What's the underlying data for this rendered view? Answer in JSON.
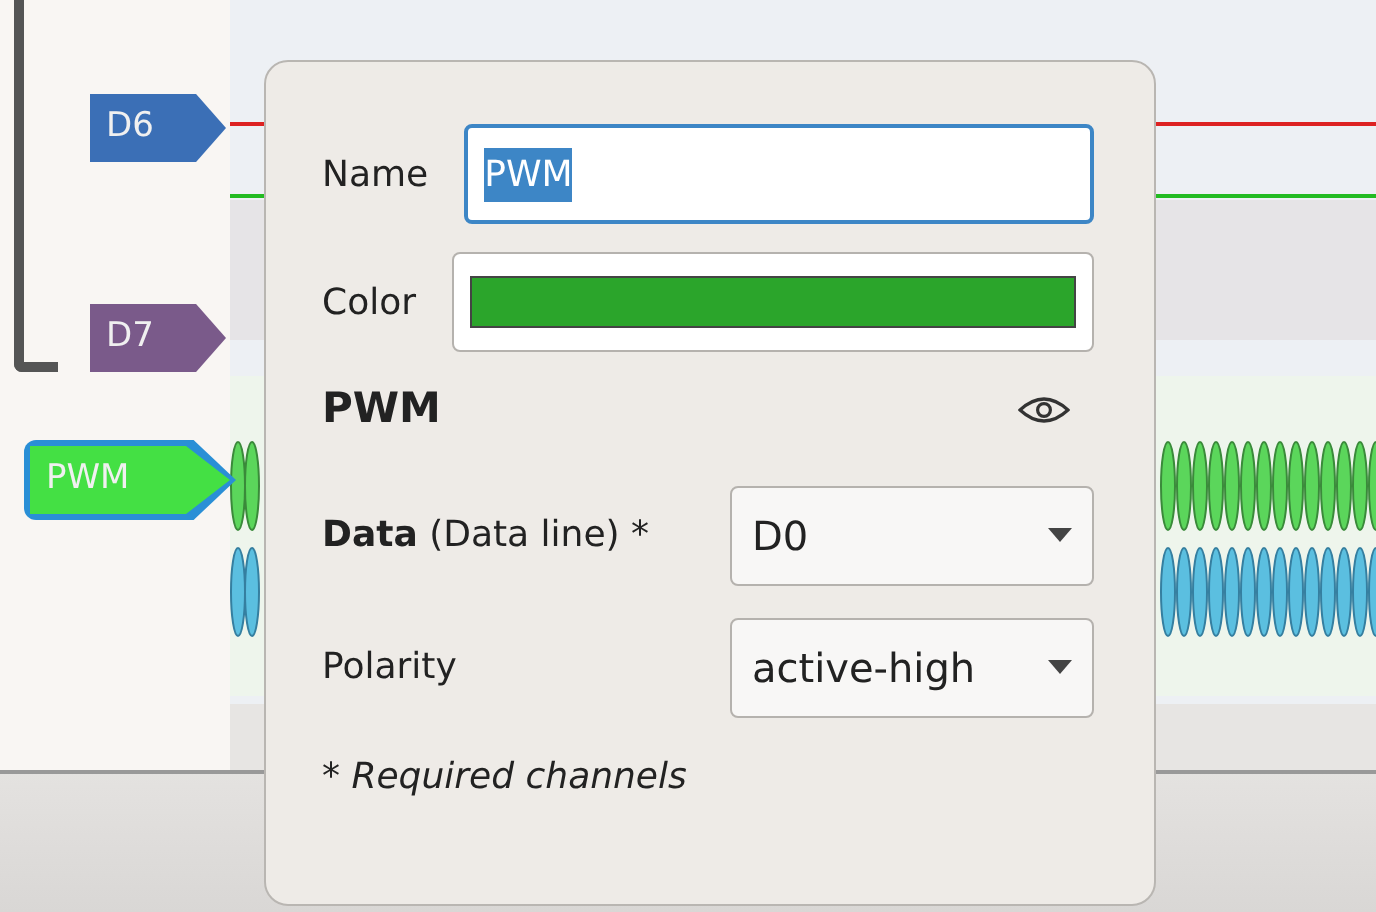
{
  "channels": [
    {
      "name": "D6",
      "color": "#3b6fb6",
      "selected": false
    },
    {
      "name": "D7",
      "color": "#7a5a8a",
      "selected": false
    },
    {
      "name": "PWM",
      "color": "#44e044",
      "selected": true
    }
  ],
  "popup": {
    "name_field": {
      "label": "Name",
      "value": "PWM",
      "text_selected": true
    },
    "color_field": {
      "label": "Color",
      "color": "#2ba52b"
    },
    "title": "PWM",
    "options": [
      {
        "label": "**Data** (Data line) *",
        "value": "D0"
      },
      {
        "label": "Polarity",
        "value": "active-high"
      }
    ],
    "note": "* Required channels"
  }
}
